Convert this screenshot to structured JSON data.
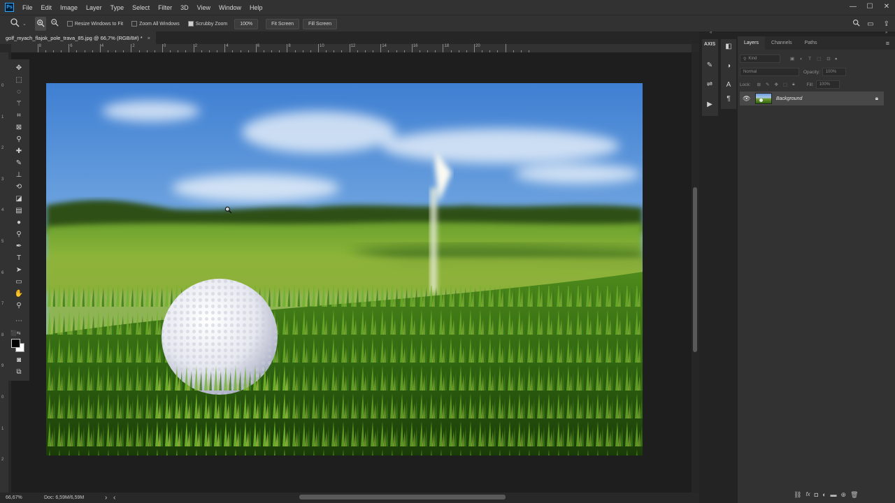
{
  "menu": {
    "app_icon": "Ps",
    "items": [
      "File",
      "Edit",
      "Image",
      "Layer",
      "Type",
      "Select",
      "Filter",
      "3D",
      "View",
      "Window",
      "Help"
    ],
    "window_controls": [
      "—",
      "☐",
      "✕"
    ]
  },
  "options_bar": {
    "resize_windows_label": "Resize Windows to Fit",
    "resize_windows_checked": false,
    "zoom_all_label": "Zoom All Windows",
    "zoom_all_checked": false,
    "scrubby_label": "Scrubby Zoom",
    "scrubby_checked": true,
    "zoom_value": "100%",
    "fit_screen": "Fit Screen",
    "fill_screen": "Fill Screen"
  },
  "document": {
    "tab_title": "golf_myach_flajok_pole_trava_85.jpg @ 66,7% (RGB/8#) *",
    "close": "×"
  },
  "rulers": {
    "h_labels": [
      "8",
      "6",
      "4",
      "2",
      "0",
      "2",
      "4",
      "6",
      "8",
      "10",
      "12",
      "14",
      "16",
      "18",
      "20"
    ],
    "v_labels": [
      "0",
      "1",
      "2",
      "3",
      "4",
      "5",
      "6",
      "7",
      "8",
      "9",
      "0",
      "1",
      "2"
    ]
  },
  "status": {
    "zoom": "66,67%",
    "doc": "Doc: 6,59M/6,59M",
    "arrow": "›",
    "scroll_left": "‹"
  },
  "panels": {
    "tabs": [
      "Layers",
      "Channels",
      "Paths"
    ],
    "active_tab": "Layers",
    "kind_label": "Kind",
    "blend_mode": "Normal",
    "opacity_label": "Opacity:",
    "opacity_value": "100%",
    "lock_label": "Lock:",
    "fill_label": "Fill:",
    "fill_value": "100%",
    "layers": [
      {
        "name": "Background",
        "visible": true,
        "locked": true
      }
    ]
  },
  "colors": {
    "accent": "#31a8ff",
    "ui_dark": "#323232",
    "canvas_bg": "#1e1e1e"
  }
}
